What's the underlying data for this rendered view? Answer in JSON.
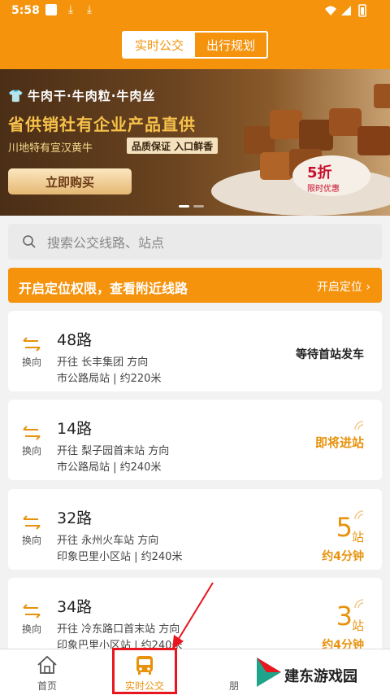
{
  "status_bar": {
    "time": "5:58"
  },
  "header": {
    "tabs": [
      {
        "label": "实时公交",
        "active": true
      },
      {
        "label": "出行规划",
        "active": false
      }
    ]
  },
  "banner": {
    "line1": "牛肉干·牛肉粒·牛肉丝",
    "line2": "省供销社有企业产品直供",
    "line3": "川地特有宣汉黄牛",
    "pill": "品质保证 入口鲜香",
    "buy_button": "立即购买",
    "discount": "5折",
    "discount_sub": "限时优惠"
  },
  "search": {
    "placeholder": "搜索公交线路、站点"
  },
  "location_banner": {
    "text": "开启定位权限，查看附近线路",
    "action": "开启定位"
  },
  "cards": [
    {
      "swap": "换向",
      "route": "48路",
      "direction": "开往 长丰集团 方向",
      "stop": "市公路局站 | 约220米",
      "status": "等待首站发车"
    },
    {
      "swap": "换向",
      "route": "14路",
      "direction": "开往 梨子园首末站 方向",
      "stop": "市公路局站 | 约240米",
      "status": "即将进站"
    },
    {
      "swap": "换向",
      "route": "32路",
      "direction": "开往 永州火车站 方向",
      "stop": "印象巴里小区站 | 约240米",
      "stops": "5",
      "stops_unit": "站",
      "eta": "约4分钟"
    },
    {
      "swap": "换向",
      "route": "34路",
      "direction": "开往 冷东路口首末站 方向",
      "stop": "印象巴里小区站 | 约240米",
      "stops": "3",
      "stops_unit": "站",
      "eta": "约4分钟"
    }
  ],
  "bottom_nav": [
    {
      "label": "首页"
    },
    {
      "label": "实时公交"
    },
    {
      "label": "朋"
    }
  ],
  "watermark": {
    "text": "建东游戏园"
  },
  "colors": {
    "accent": "#f5930d",
    "highlight": "#e8161f"
  }
}
